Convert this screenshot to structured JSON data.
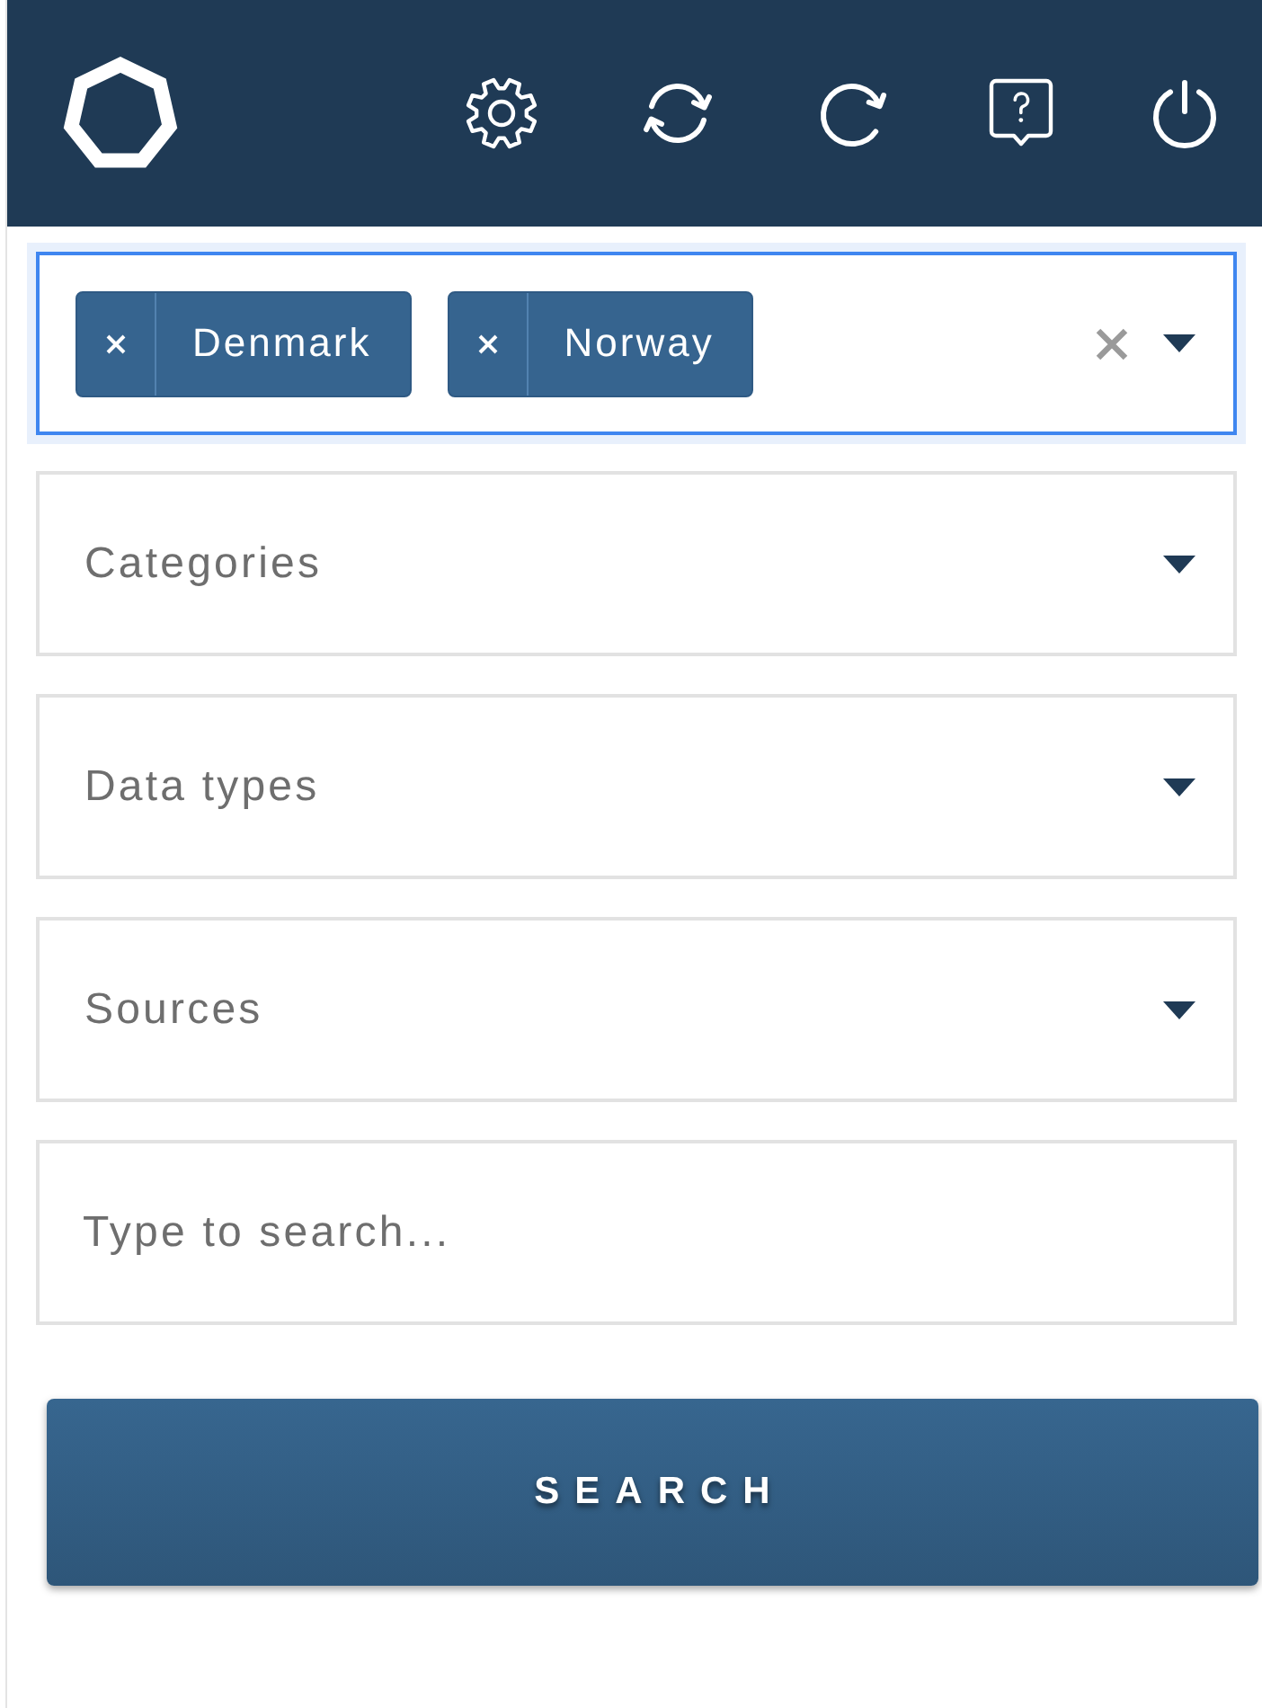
{
  "country_select": {
    "focused": true,
    "tags": [
      {
        "label": "Denmark"
      },
      {
        "label": "Norway"
      }
    ]
  },
  "filters": [
    {
      "placeholder": "Categories"
    },
    {
      "placeholder": "Data types"
    },
    {
      "placeholder": "Sources"
    }
  ],
  "search_field": {
    "placeholder": "Type to search..."
  },
  "search_button": {
    "label": "SEARCH"
  }
}
